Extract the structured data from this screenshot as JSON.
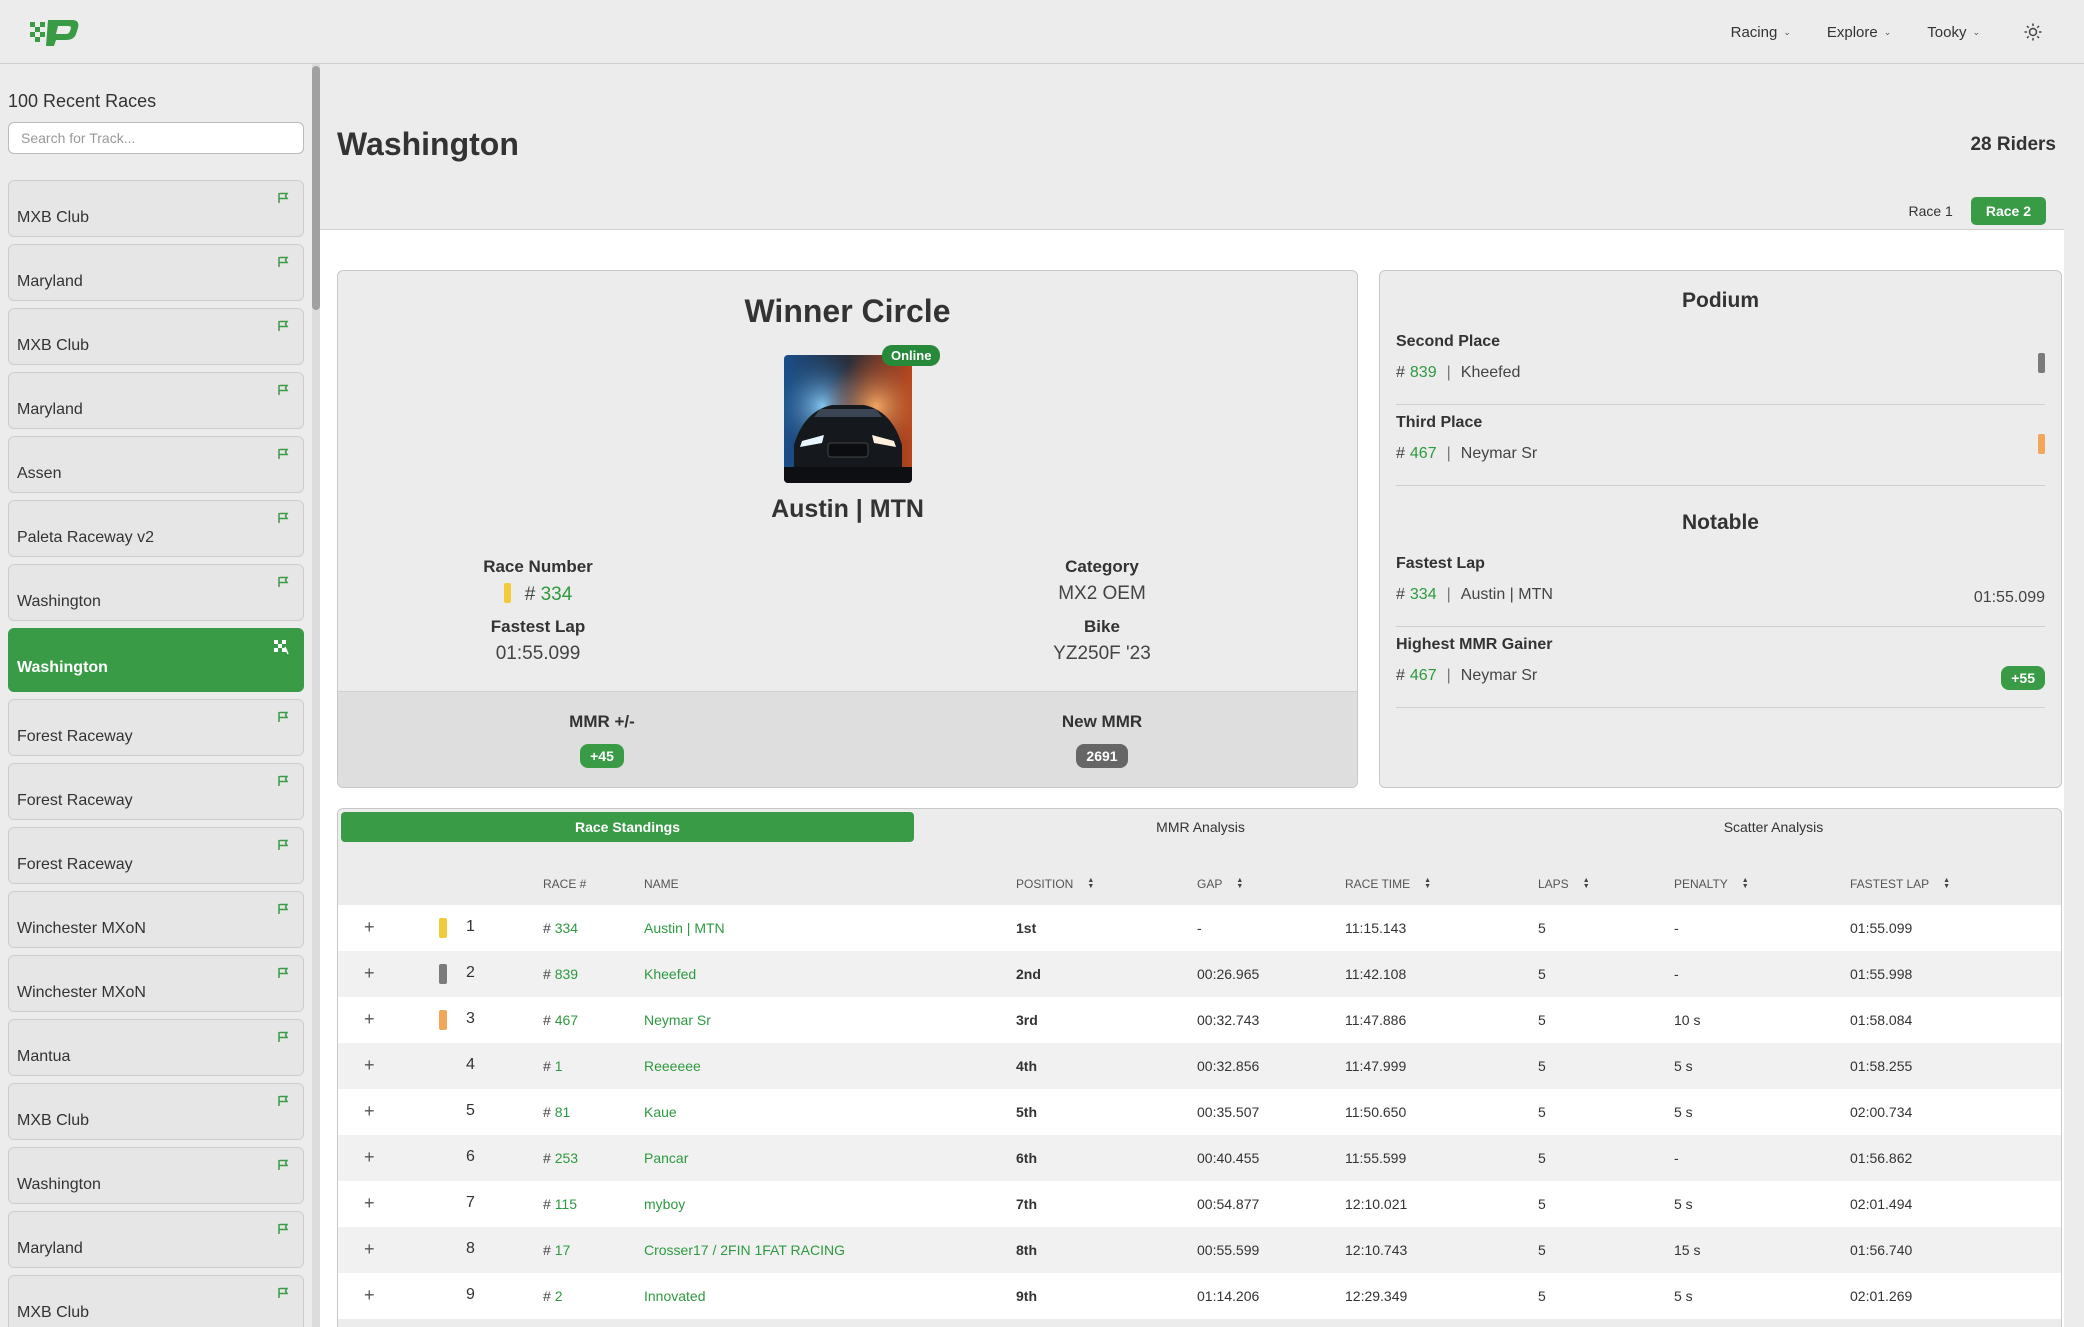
{
  "nav": {
    "items": [
      {
        "label": "Racing"
      },
      {
        "label": "Explore"
      },
      {
        "label": "Tooky"
      }
    ]
  },
  "sidebar": {
    "title": "100 Recent Races",
    "search_placeholder": "Search for Track...",
    "races": [
      {
        "name": "MXB Club",
        "active": false
      },
      {
        "name": "Maryland",
        "active": false
      },
      {
        "name": "MXB Club",
        "active": false
      },
      {
        "name": "Maryland",
        "active": false
      },
      {
        "name": "Assen",
        "active": false
      },
      {
        "name": "Paleta Raceway v2",
        "active": false
      },
      {
        "name": "Washington",
        "active": false
      },
      {
        "name": "Washington",
        "active": true
      },
      {
        "name": "Forest Raceway",
        "active": false
      },
      {
        "name": "Forest Raceway",
        "active": false
      },
      {
        "name": "Forest Raceway",
        "active": false
      },
      {
        "name": "Winchester MXoN",
        "active": false
      },
      {
        "name": "Winchester MXoN",
        "active": false
      },
      {
        "name": "Mantua",
        "active": false
      },
      {
        "name": "MXB Club",
        "active": false
      },
      {
        "name": "Washington",
        "active": false
      },
      {
        "name": "Maryland",
        "active": false
      },
      {
        "name": "MXB Club",
        "active": false
      }
    ]
  },
  "header": {
    "title": "Washington",
    "riders": "28 Riders",
    "race_tabs": [
      {
        "label": "Race 1",
        "active": false
      },
      {
        "label": "Race 2",
        "active": true
      }
    ]
  },
  "winner": {
    "title": "Winner Circle",
    "status": "Online",
    "name": "Austin | MTN",
    "race_number_label": "Race Number",
    "hash": "#",
    "race_number": "334",
    "category_label": "Category",
    "category": "MX2 OEM",
    "fastest_lap_label": "Fastest Lap",
    "fastest_lap": "01:55.099",
    "bike_label": "Bike",
    "bike": "YZ250F '23",
    "mmr_change_label": "MMR +/-",
    "mmr_change": "+45",
    "new_mmr_label": "New MMR",
    "new_mmr": "2691"
  },
  "podium": {
    "heading": "Podium",
    "second": {
      "label": "Second Place",
      "hash": "#",
      "number": "839",
      "sep": "|",
      "name": "Kheefed"
    },
    "third": {
      "label": "Third Place",
      "hash": "#",
      "number": "467",
      "sep": "|",
      "name": "Neymar Sr"
    },
    "notable_heading": "Notable",
    "fastest": {
      "label": "Fastest Lap",
      "hash": "#",
      "number": "334",
      "sep": "|",
      "name": "Austin | MTN",
      "value": "01:55.099"
    },
    "mmr_gainer": {
      "label": "Highest MMR Gainer",
      "hash": "#",
      "number": "467",
      "sep": "|",
      "name": "Neymar Sr",
      "value": "+55"
    }
  },
  "standings": {
    "tabs": [
      {
        "label": "Race Standings",
        "active": true
      },
      {
        "label": "MMR Analysis",
        "active": false
      },
      {
        "label": "Scatter Analysis",
        "active": false
      }
    ],
    "columns": {
      "race_num": "RACE #",
      "name": "NAME",
      "position": "POSITION",
      "gap": "GAP",
      "race_time": "RACE TIME",
      "laps": "LAPS",
      "penalty": "PENALTY",
      "fastest_lap": "FASTEST LAP"
    },
    "colors": {
      "gold": "#f2cb3b",
      "silver": "#7b7b7b",
      "bronze": "#f2a65a",
      "accent": "#3a9b47"
    },
    "rows": [
      {
        "expand": "+",
        "marker": "gold",
        "place": "1",
        "hash": "#",
        "num": "334",
        "name": "Austin | MTN",
        "position": "1st",
        "gap": "-",
        "time": "11:15.143",
        "laps": "5",
        "penalty": "-",
        "fastest": "01:55.099"
      },
      {
        "expand": "+",
        "marker": "silver",
        "place": "2",
        "hash": "#",
        "num": "839",
        "name": "Kheefed",
        "position": "2nd",
        "gap": "00:26.965",
        "time": "11:42.108",
        "laps": "5",
        "penalty": "-",
        "fastest": "01:55.998"
      },
      {
        "expand": "+",
        "marker": "bronze",
        "place": "3",
        "hash": "#",
        "num": "467",
        "name": "Neymar Sr",
        "position": "3rd",
        "gap": "00:32.743",
        "time": "11:47.886",
        "laps": "5",
        "penalty": "10 s",
        "fastest": "01:58.084"
      },
      {
        "expand": "+",
        "marker": "",
        "place": "4",
        "hash": "#",
        "num": "1",
        "name": "Reeeeee",
        "position": "4th",
        "gap": "00:32.856",
        "time": "11:47.999",
        "laps": "5",
        "penalty": "5 s",
        "fastest": "01:58.255"
      },
      {
        "expand": "+",
        "marker": "",
        "place": "5",
        "hash": "#",
        "num": "81",
        "name": "Kaue",
        "position": "5th",
        "gap": "00:35.507",
        "time": "11:50.650",
        "laps": "5",
        "penalty": "5 s",
        "fastest": "02:00.734"
      },
      {
        "expand": "+",
        "marker": "",
        "place": "6",
        "hash": "#",
        "num": "253",
        "name": "Pancar",
        "position": "6th",
        "gap": "00:40.455",
        "time": "11:55.599",
        "laps": "5",
        "penalty": "-",
        "fastest": "01:56.862"
      },
      {
        "expand": "+",
        "marker": "",
        "place": "7",
        "hash": "#",
        "num": "115",
        "name": "myboy",
        "position": "7th",
        "gap": "00:54.877",
        "time": "12:10.021",
        "laps": "5",
        "penalty": "5 s",
        "fastest": "02:01.494"
      },
      {
        "expand": "+",
        "marker": "",
        "place": "8",
        "hash": "#",
        "num": "17",
        "name": "Crosser17 / 2FIN 1FAT RACING",
        "position": "8th",
        "gap": "00:55.599",
        "time": "12:10.743",
        "laps": "5",
        "penalty": "15 s",
        "fastest": "01:56.740"
      },
      {
        "expand": "+",
        "marker": "",
        "place": "9",
        "hash": "#",
        "num": "2",
        "name": "Innovated",
        "position": "9th",
        "gap": "01:14.206",
        "time": "12:29.349",
        "laps": "5",
        "penalty": "5 s",
        "fastest": "02:01.269"
      }
    ]
  }
}
